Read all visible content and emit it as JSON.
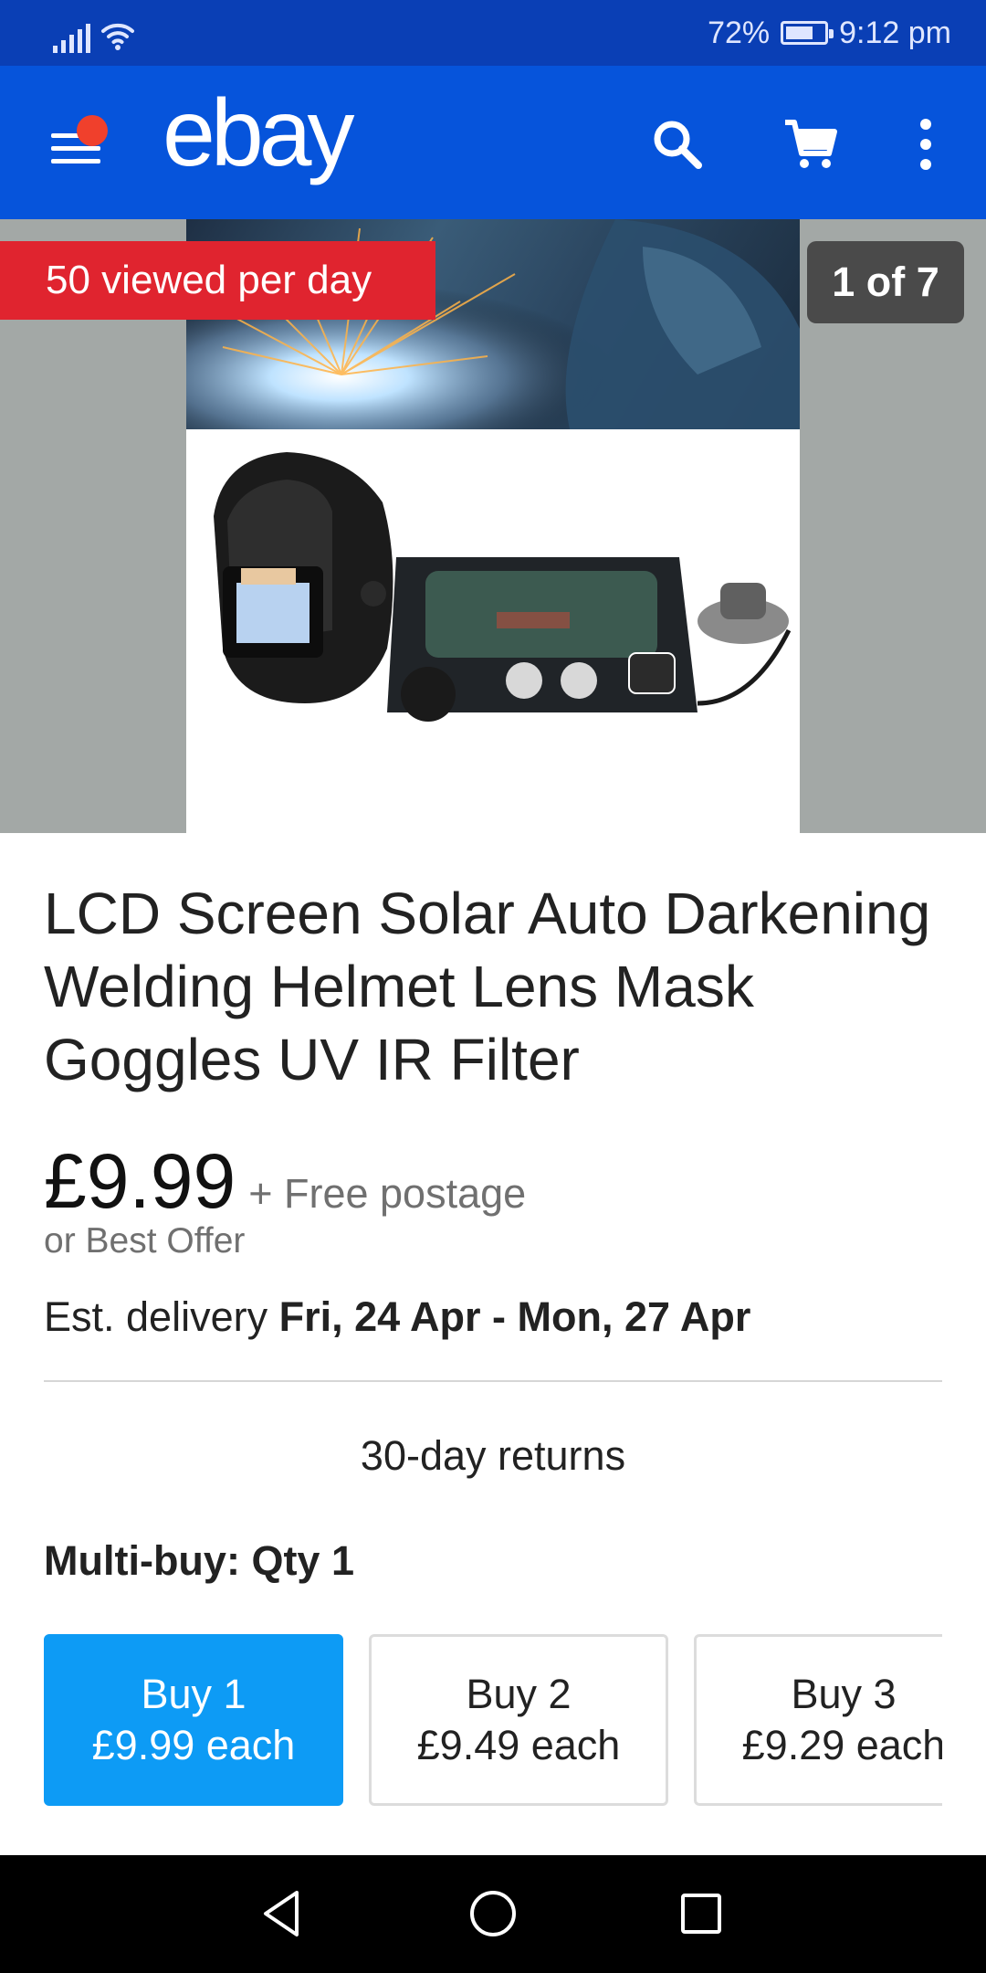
{
  "status_bar": {
    "battery": "72%",
    "battery_level": 0.72,
    "time": "9:12 pm",
    "icons": [
      "signal-icon",
      "wifi-icon",
      "battery-icon"
    ]
  },
  "app_bar": {
    "logo": "ebay",
    "icons": [
      "menu-icon",
      "search-icon",
      "cart-icon",
      "more-vert-icon"
    ],
    "colors": {
      "background": "#0654db",
      "notification_dot": "#f0402c"
    }
  },
  "gallery": {
    "viewed_badge": "50 viewed per day",
    "page_indicator": "1 of 7",
    "image": "welding-helmet-and-lens-product-photo"
  },
  "listing": {
    "title": "LCD Screen Solar Auto Darkening Welding Helmet Lens Mask Goggles UV IR Filter",
    "price": "£9.99",
    "postage": "+ Free postage",
    "best_offer": "or Best Offer",
    "delivery_label": "Est. delivery",
    "delivery_dates": "Fri, 24 Apr - Mon, 27 Apr",
    "returns": "30-day returns",
    "multibuy": "Multi-buy: Qty 1"
  },
  "buy_options": [
    {
      "label": "Buy 1",
      "price": "£9.99 each",
      "selected": true
    },
    {
      "label": "Buy 2",
      "price": "£9.49 each",
      "selected": false
    },
    {
      "label": "Buy 3",
      "price": "£9.29 each",
      "selected": false
    }
  ],
  "nav_bar": {
    "icons": [
      "back-icon",
      "home-icon",
      "recents-icon"
    ]
  },
  "colors": {
    "selected_option": "#0d9bf5",
    "viewed_badge": "#e0242f"
  }
}
